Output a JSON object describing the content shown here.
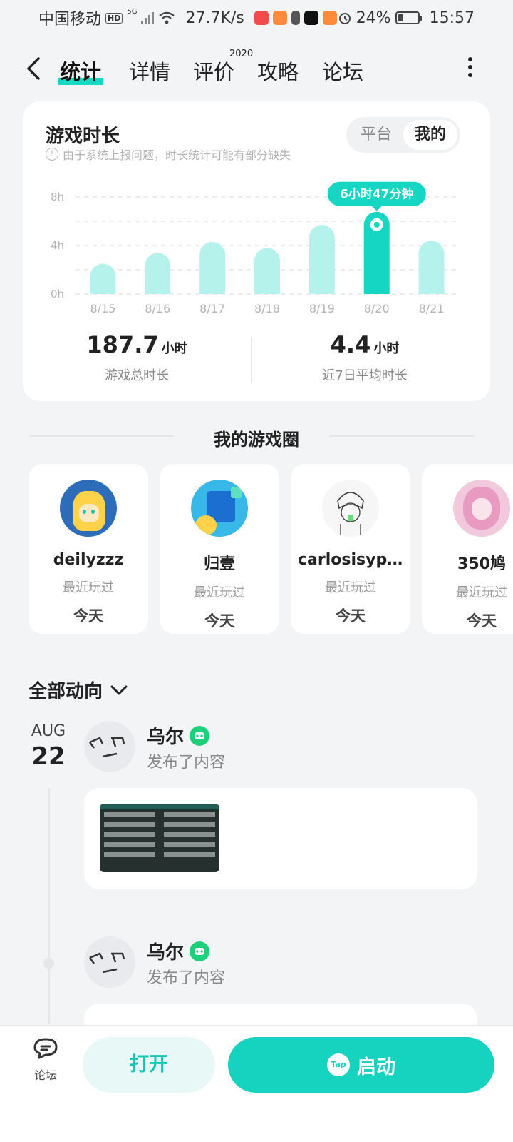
{
  "status_bar": {
    "carrier": "中国移动",
    "hd": "HD",
    "network": "5G",
    "speed": "27.7K/s",
    "battery": "24%",
    "time": "15:57"
  },
  "nav": {
    "tabs": [
      "统计",
      "详情",
      "评价",
      "攻略",
      "论坛"
    ],
    "review_superscript": "2020"
  },
  "stats": {
    "title": "游戏时长",
    "note": "由于系统上报问题，时长统计可能有部分缺失",
    "segment": [
      "平台",
      "我的"
    ],
    "selected_segment": "我的",
    "highlight_label": "6小时47分钟",
    "total_value": "187.7",
    "total_unit": "小时",
    "total_label": "游戏总时长",
    "avg_value": "4.4",
    "avg_unit": "小时",
    "avg_label": "近7日平均时长"
  },
  "chart_data": {
    "type": "bar",
    "categories": [
      "8/15",
      "8/16",
      "8/17",
      "8/18",
      "8/19",
      "8/20",
      "8/21"
    ],
    "values": [
      2.5,
      3.4,
      4.3,
      3.8,
      5.7,
      6.78,
      4.4
    ],
    "yticks": [
      "0h",
      "4h",
      "8h"
    ],
    "ylim": [
      0,
      8
    ],
    "highlight_index": 5,
    "colors": {
      "bar": "#b6f2ec",
      "highlight": "#14d6c3"
    }
  },
  "game_circle": {
    "title": "我的游戏圈",
    "friends": [
      {
        "name": "deilyzzz",
        "sub": "最近玩过",
        "when": "今天"
      },
      {
        "name": "归壹",
        "sub": "最近玩过",
        "when": "今天"
      },
      {
        "name": "carlosisyp...",
        "sub": "最近玩过",
        "when": "今天"
      },
      {
        "name": "350鸠",
        "sub": "最近玩过",
        "when": "今天"
      }
    ]
  },
  "activity": {
    "header": "全部动向",
    "month": "AUG",
    "day": "22",
    "posts": [
      {
        "author": "乌尔",
        "action": "发布了内容"
      },
      {
        "author": "乌尔",
        "action": "发布了内容"
      }
    ]
  },
  "bottom_bar": {
    "forum_label": "论坛",
    "open_label": "打开",
    "start_label": "启动",
    "tap_logo": "Tap"
  },
  "colors": {
    "accent": "#14d6c3",
    "bar_light": "#b6f2ec",
    "background": "#f3f4f6",
    "badge_green": "#1fd07a"
  }
}
